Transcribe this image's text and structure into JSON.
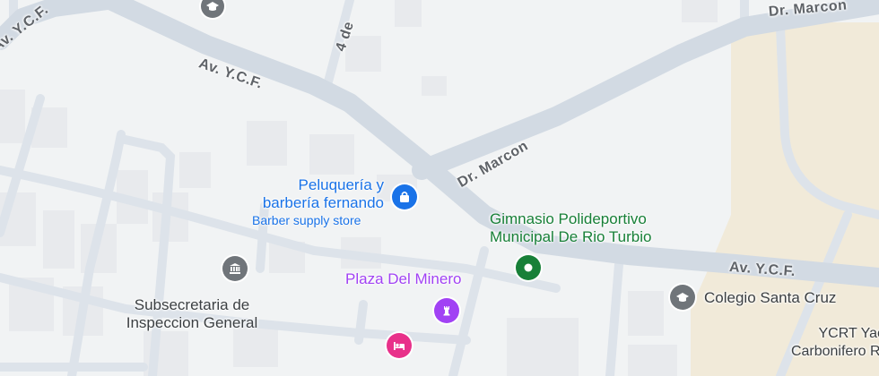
{
  "roads": {
    "ycf_top_left": "Av. Y.C.F.",
    "ycf_mid": "Av. Y.C.F.",
    "ycf_right": "Av. Y.C.F.",
    "marcon_top": "Dr. Marcon",
    "marcon_diag": "Dr. Marcon",
    "cuatro_de": "4 de"
  },
  "pois": {
    "peluqueria": {
      "name_line1": "Peluquería y",
      "name_line2": "barbería fernando",
      "category": "Barber supply store",
      "icon": "shopping-bag-icon",
      "color": "#1a73e8"
    },
    "gimnasio": {
      "name_line1": "Gimnasio Polideportivo",
      "name_line2": "Municipal De Rio Turbio",
      "icon": "place-icon",
      "color": "#188038"
    },
    "plaza": {
      "name": "Plaza Del Minero",
      "icon": "monument-icon",
      "color": "#a142f4"
    },
    "subsecretaria": {
      "name_line1": "Subsecretaria de",
      "name_line2": "Inspeccion General",
      "icon": "government-building-icon",
      "color": "#70757a"
    },
    "colegio": {
      "name": "Colegio Santa Cruz",
      "icon": "school-icon",
      "color": "#70757a"
    },
    "ycrt": {
      "name_line1": "YCRT Yac",
      "name_line2": "Carbonifero Rí"
    },
    "hotel": {
      "icon": "hotel-icon",
      "color": "#e8318a"
    },
    "top_school": {
      "icon": "school-icon",
      "color": "#70757a"
    }
  }
}
